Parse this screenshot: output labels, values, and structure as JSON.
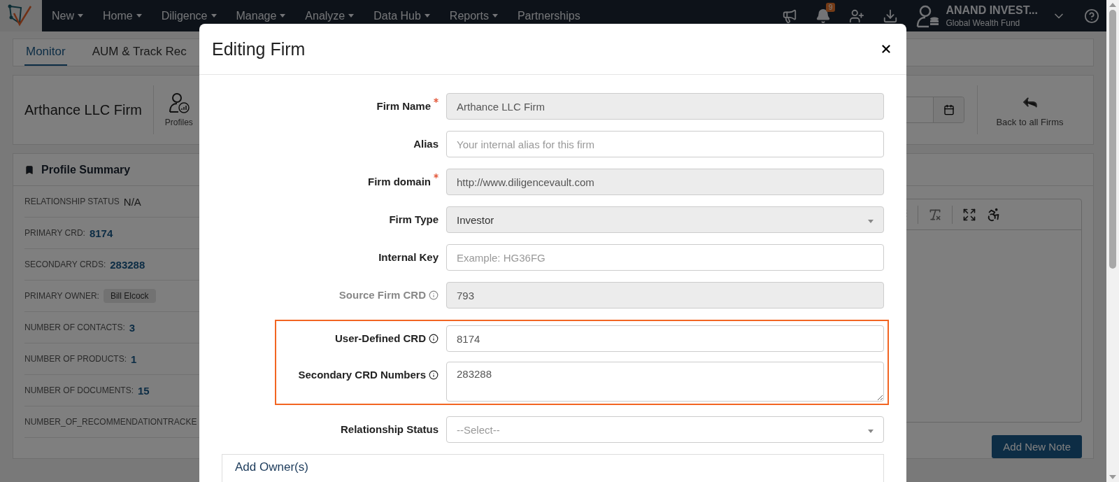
{
  "nav": {
    "items": [
      {
        "label": "New",
        "dropdown": true
      },
      {
        "label": "Home",
        "dropdown": true
      },
      {
        "label": "Diligence",
        "dropdown": true
      },
      {
        "label": "Manage",
        "dropdown": true
      },
      {
        "label": "Analyze",
        "dropdown": true
      },
      {
        "label": "Data Hub",
        "dropdown": true
      },
      {
        "label": "Reports",
        "dropdown": true
      },
      {
        "label": "Partnerships",
        "dropdown": false
      }
    ],
    "notification_count": "9",
    "account": {
      "name": "ANAND INVEST...",
      "fund": "Global Wealth Fund"
    }
  },
  "page": {
    "tabs": [
      {
        "label": "Monitor",
        "selected": true
      },
      {
        "label": "AUM & Track Rec",
        "selected": false
      }
    ],
    "firm_name": "Arthance LLC Firm",
    "profiles_label": "Profiles",
    "back_label": "Back to all Firms",
    "summary": {
      "title": "Profile Summary",
      "rows": [
        {
          "label": "RELATIONSHIP STATUS",
          "value": "N/A",
          "kind": "plain"
        },
        {
          "label": "PRIMARY CRD:",
          "value": "8174",
          "kind": "link"
        },
        {
          "label": "SECONDARY CRDS:",
          "value": "283288",
          "kind": "link"
        },
        {
          "label": "PRIMARY OWNER:",
          "value": "Bill Elcock",
          "kind": "tag"
        },
        {
          "label": "NUMBER OF CONTACTS:",
          "value": "3",
          "kind": "link"
        },
        {
          "label": "NUMBER OF PRODUCTS:",
          "value": "1",
          "kind": "link"
        },
        {
          "label": "NUMBER OF DOCUMENTS:",
          "value": "15",
          "kind": "link"
        },
        {
          "label": "NUMBER_OF_RECOMMENDATIONTRACKE",
          "kind": "plain"
        }
      ]
    },
    "add_note_button": "Add New Note"
  },
  "modal": {
    "title": "Editing Firm",
    "fields": [
      {
        "label": "Firm Name",
        "kind": "text",
        "value": "Arthance LLC Firm",
        "required": true,
        "info": false,
        "readonly": true,
        "disabled": false,
        "highlighted": false
      },
      {
        "label": "Alias",
        "kind": "text",
        "placeholder": "Your internal alias for this firm",
        "required": false,
        "info": false,
        "readonly": false,
        "disabled": false,
        "highlighted": false
      },
      {
        "label": "Firm domain",
        "kind": "text",
        "value": "http://www.diligencevault.com",
        "required": true,
        "info": false,
        "readonly": true,
        "disabled": false,
        "highlighted": false
      },
      {
        "label": "Firm Type",
        "kind": "select",
        "value": "Investor",
        "required": false,
        "info": false,
        "readonly": true,
        "disabled": false,
        "highlighted": false
      },
      {
        "label": "Internal Key",
        "kind": "text",
        "placeholder": "Example: HG36FG",
        "required": false,
        "info": false,
        "readonly": false,
        "disabled": false,
        "highlighted": false
      },
      {
        "label": "Source Firm CRD",
        "kind": "text",
        "value": "793",
        "required": false,
        "info": true,
        "readonly": true,
        "disabled": true,
        "highlighted": false
      },
      {
        "label": "User-Defined CRD",
        "kind": "text",
        "value": "8174",
        "required": false,
        "info": true,
        "readonly": false,
        "disabled": false,
        "highlighted": true
      },
      {
        "label": "Secondary CRD Numbers",
        "kind": "textarea",
        "value": "283288",
        "required": false,
        "info": true,
        "readonly": false,
        "disabled": false,
        "highlighted": true
      },
      {
        "label": "Relationship Status",
        "kind": "select",
        "placeholder": "--Select--",
        "required": false,
        "info": false,
        "readonly": false,
        "disabled": false,
        "highlighted": false
      }
    ],
    "section": "Add Owner(s)"
  }
}
